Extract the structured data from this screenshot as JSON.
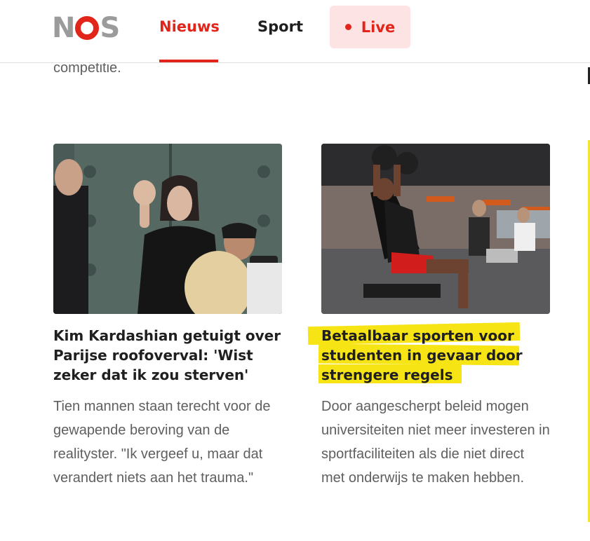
{
  "header": {
    "logo_text": "NOS",
    "nav": {
      "news": "Nieuws",
      "sport": "Sport",
      "live": "Live"
    },
    "accent_color": "#e1251b"
  },
  "previous_snippet": "competitie.",
  "articles": [
    {
      "image_description": "Kim Kardashian waving in front of a large metal door",
      "title": "Kim Kardashian getuigt over Parijse roofoverval: 'Wist zeker dat ik zou sterven'",
      "summary": "Tien mannen staan terecht voor de gewapende beroving van de realityster. \"Ik vergeef u, maar dat verandert niets aan het trauma.\""
    },
    {
      "image_description": "Students lifting weights in a gym",
      "title": "Betaalbaar sporten voor studenten in gevaar door strengere regels",
      "title_lines": [
        "Betaalbaar sporten voor",
        "studenten in gevaar door",
        "strengere regels"
      ],
      "summary": "Door aangescherpt beleid mogen universiteiten niet meer investeren in sportfaciliteiten als die niet direct met onderwijs te maken hebben.",
      "highlight_color": "#f7e415"
    }
  ]
}
